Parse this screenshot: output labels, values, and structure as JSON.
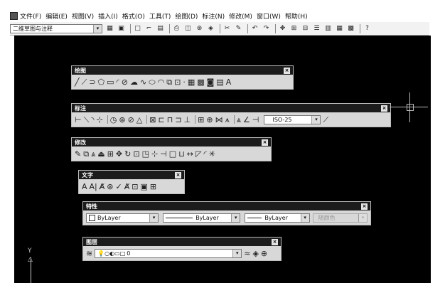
{
  "menubar": {
    "items": [
      "文件(F)",
      "编辑(E)",
      "视图(V)",
      "插入(I)",
      "格式(O)",
      "工具(T)",
      "绘图(D)",
      "标注(N)",
      "修改(M)",
      "窗口(W)",
      "帮助(H)"
    ]
  },
  "workspace": {
    "value": "二维草图与注释"
  },
  "panels": {
    "draw": {
      "title": "绘图"
    },
    "dimension": {
      "title": "标注",
      "dimstyle": "ISO-25"
    },
    "modify": {
      "title": "修改"
    },
    "text": {
      "title": "文字"
    },
    "properties": {
      "title": "特性",
      "color": "ByLayer",
      "linetype": "ByLayer",
      "lineweight": "ByLayer",
      "plotstyle": "随颜色"
    },
    "layers": {
      "title": "图层",
      "current": "0"
    }
  },
  "ucs": {
    "y_label": "Y"
  }
}
